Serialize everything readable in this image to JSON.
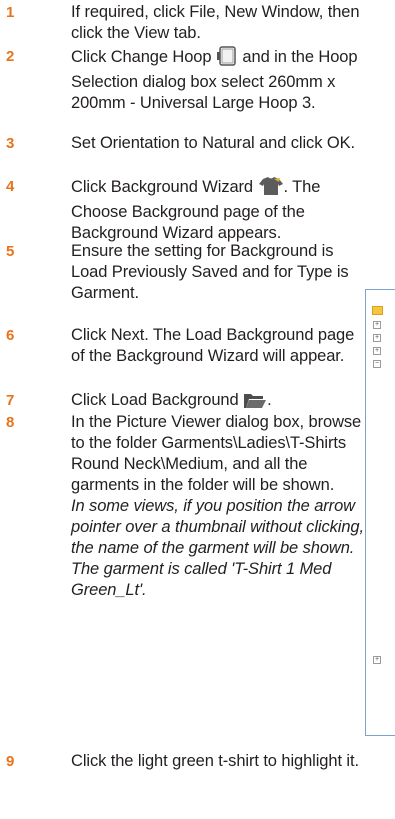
{
  "steps": [
    {
      "num": "1",
      "text": "If required, click File, New Window, then click the View tab."
    },
    {
      "num": "2",
      "text_before": "Click Change Hoop",
      "text_after": " and in the Hoop Selection dialog box select 260mm x 200mm - Universal Large Hoop 3.",
      "icon": "hoop-icon"
    },
    {
      "num": "3",
      "text": "Set Orientation to Natural and click OK."
    },
    {
      "num": "4",
      "text_before": "Click Background Wizard",
      "text_after": ". The Choose Background page of the Background Wizard appears.",
      "icon": "tshirt-wizard-icon"
    },
    {
      "num": "5",
      "text": "Ensure the setting for Background is Load Previously Saved and for Type is Garment."
    },
    {
      "num": "6",
      "text": "Click Next. The Load Background page of the Background Wizard will appear."
    },
    {
      "num": "7",
      "text_before": "Click Load Background",
      "text_after": ".",
      "icon": "open-folder-icon"
    },
    {
      "num": "8",
      "text": "In the Picture Viewer dialog box, browse to the folder Garments\\Ladies\\T-Shirts Round Neck\\Medium, and all the garments in the folder will be shown.",
      "note": "In some views, if you position the arrow pointer over a thumbnail without clicking, the name of the garment will be shown. The garment is called 'T-Shirt 1 Med Green_Lt'."
    },
    {
      "num": "9",
      "text": "Click the light green t-shirt to highlight it."
    }
  ],
  "colors": {
    "step_number": "#e8731a",
    "body_text": "#231f20",
    "window_border": "#7da2ce"
  }
}
